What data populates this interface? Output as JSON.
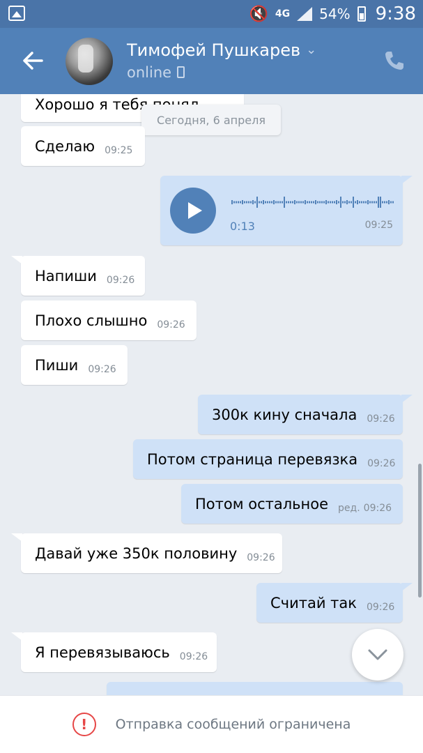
{
  "status_bar": {
    "network": "4G",
    "battery": "54%",
    "time": "9:38"
  },
  "header": {
    "name": "Тимофей Пушкарев",
    "status": "online"
  },
  "date_separator": "Сегодня, 6 апреля",
  "messages": [
    {
      "dir": "in",
      "text": "Хорошо я тебя понял",
      "time": ""
    },
    {
      "dir": "in",
      "text": "Сделаю",
      "time": "09:25"
    },
    {
      "dir": "out",
      "type": "voice",
      "duration": "0:13",
      "time": "09:25"
    },
    {
      "dir": "in",
      "text": "Напиши",
      "time": "09:26"
    },
    {
      "dir": "in",
      "text": "Плохо слышно",
      "time": "09:26"
    },
    {
      "dir": "in",
      "text": "Пиши",
      "time": "09:26"
    },
    {
      "dir": "out",
      "text": "300к кину сначала",
      "time": "09:26"
    },
    {
      "dir": "out",
      "text": "Потом страница перевязка",
      "time": "09:26"
    },
    {
      "dir": "out",
      "text": "Потом остальное",
      "edited": "ред.",
      "time": "09:26"
    },
    {
      "dir": "in",
      "text": "Давай уже 350к половину",
      "time": "09:26"
    },
    {
      "dir": "out",
      "text": "Считай так",
      "time": "09:26"
    },
    {
      "dir": "in",
      "text": "Я перевязываюсь",
      "time": "09:26"
    }
  ],
  "bottom_bar": {
    "notice": "Отправка сообщений ограничена"
  },
  "colors": {
    "header": "#5181b8",
    "status_bar": "#4a74a8",
    "outgoing_bubble": "#cfe1f7",
    "incoming_bubble": "#ffffff",
    "background": "#e9edf2",
    "warning": "#e64646"
  }
}
